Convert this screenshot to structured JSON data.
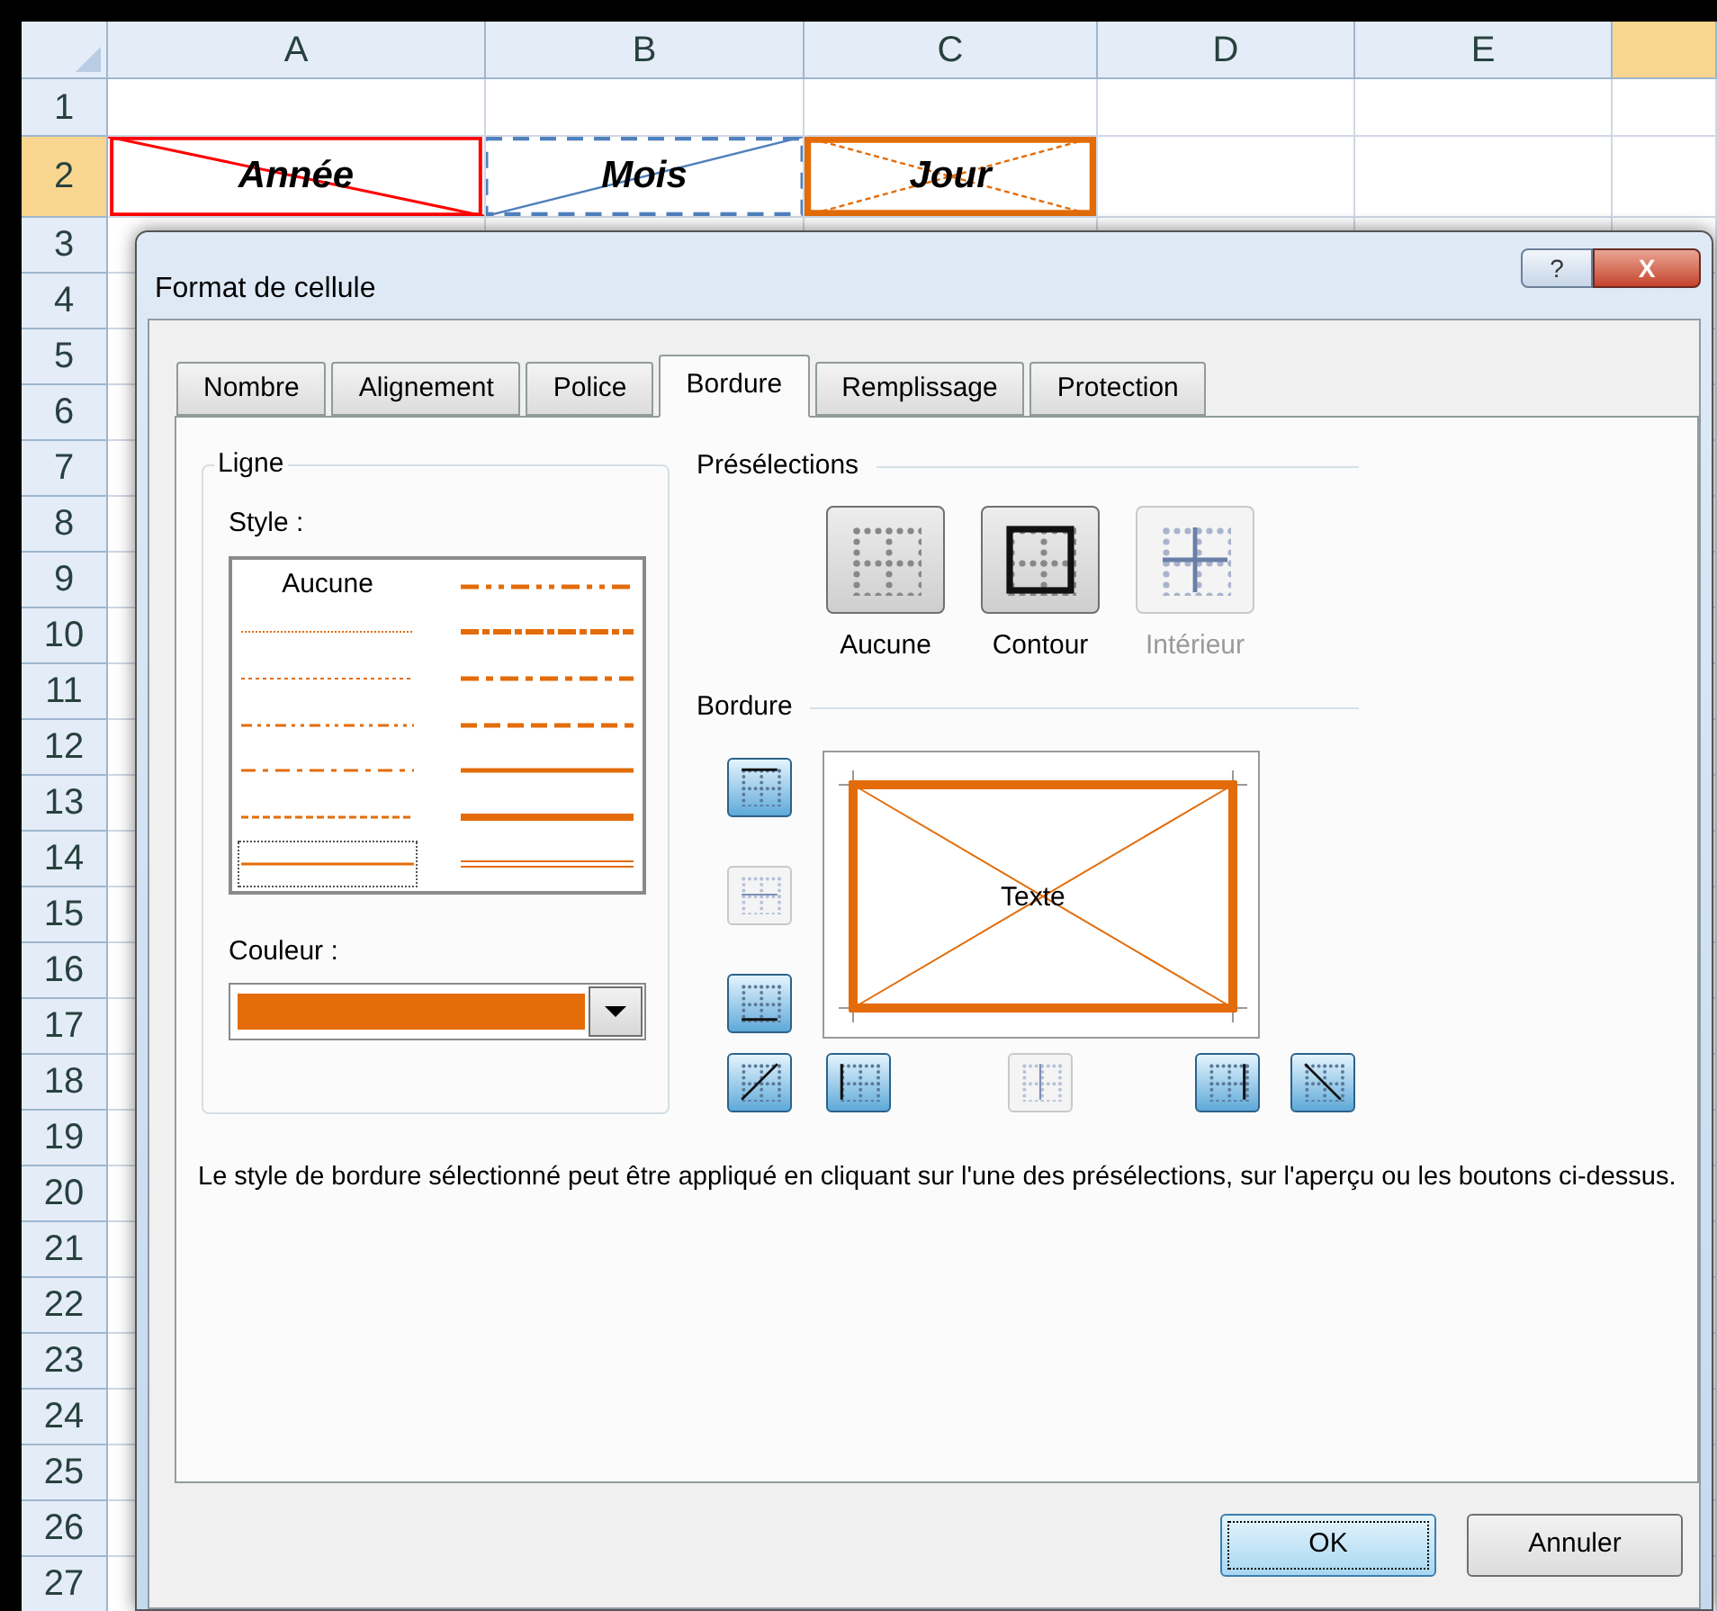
{
  "sheet": {
    "columns": [
      {
        "label": "A",
        "selected": false
      },
      {
        "label": "B",
        "selected": false
      },
      {
        "label": "C",
        "selected": false
      },
      {
        "label": "D",
        "selected": false
      },
      {
        "label": "E",
        "selected": false
      },
      {
        "selected": true
      }
    ],
    "rows": [
      {
        "label": "1",
        "selected": false
      },
      {
        "label": "2",
        "selected": true
      },
      {
        "label": "3",
        "selected": false
      },
      {
        "label": "4",
        "selected": false
      },
      {
        "label": "5",
        "selected": false
      },
      {
        "label": "6",
        "selected": false
      },
      {
        "label": "7",
        "selected": false
      },
      {
        "label": "8",
        "selected": false
      },
      {
        "label": "9",
        "selected": false
      },
      {
        "label": "10",
        "selected": false
      },
      {
        "label": "11",
        "selected": false
      },
      {
        "label": "12",
        "selected": false
      },
      {
        "label": "13",
        "selected": false
      },
      {
        "label": "14",
        "selected": false
      },
      {
        "label": "15",
        "selected": false
      },
      {
        "label": "16",
        "selected": false
      },
      {
        "label": "17",
        "selected": false
      },
      {
        "label": "18",
        "selected": false
      },
      {
        "label": "19",
        "selected": false
      },
      {
        "label": "20",
        "selected": false
      },
      {
        "label": "21",
        "selected": false
      },
      {
        "label": "22",
        "selected": false
      },
      {
        "label": "23",
        "selected": false
      },
      {
        "label": "24",
        "selected": false
      },
      {
        "label": "25",
        "selected": false
      },
      {
        "label": "26",
        "selected": false
      },
      {
        "label": "27",
        "selected": false
      }
    ],
    "cells": [
      {
        "text": "Année",
        "color": "#ff0000",
        "kind": "solid-diagonal-down"
      },
      {
        "text": "Mois",
        "color": "#4f81bd",
        "kind": "dashed-diagonal-up"
      },
      {
        "text": "Jour",
        "color": "#e36c09",
        "kind": "thick-cross"
      }
    ]
  },
  "dialog": {
    "title": "Format de cellule",
    "help": "?",
    "close": "X",
    "tabs": [
      {
        "label": "Nombre",
        "selected": false
      },
      {
        "label": "Alignement",
        "selected": false
      },
      {
        "label": "Police",
        "selected": false
      },
      {
        "label": "Bordure",
        "selected": true
      },
      {
        "label": "Remplissage",
        "selected": false
      },
      {
        "label": "Protection",
        "selected": false
      }
    ],
    "line_group": {
      "title": "Ligne",
      "style_label": "Style :",
      "styles": [
        {
          "kind": "none",
          "text": "Aucune",
          "selected": false
        },
        {
          "kind": "hair",
          "selected": false
        },
        {
          "kind": "dotted",
          "selected": false
        },
        {
          "kind": "dash-dot-dot",
          "selected": false
        },
        {
          "kind": "dash-dot",
          "selected": false
        },
        {
          "kind": "dashed",
          "selected": false
        },
        {
          "kind": "thin",
          "selected": true
        },
        {
          "kind": "medium-dash-dot-dot",
          "selected": false
        },
        {
          "kind": "slanted-dash-dot",
          "selected": false
        },
        {
          "kind": "medium-dash-dot",
          "selected": false
        },
        {
          "kind": "medium-dashed",
          "selected": false
        },
        {
          "kind": "medium",
          "selected": false
        },
        {
          "kind": "thick",
          "selected": false
        },
        {
          "kind": "double",
          "selected": false
        }
      ],
      "color_label": "Couleur :",
      "color": "#e36c09"
    },
    "presets_label": "Présélections",
    "presets": [
      {
        "kind": "none",
        "label": "Aucune",
        "disabled": false
      },
      {
        "kind": "outline",
        "label": "Contour",
        "disabled": false
      },
      {
        "kind": "inside",
        "label": "Intérieur",
        "disabled": true
      }
    ],
    "border_label": "Bordure",
    "preview_text": "Texte",
    "border_buttons": [
      {
        "kind": "top",
        "on": true,
        "disabled": false
      },
      {
        "kind": "middle-horizontal",
        "on": false,
        "disabled": true
      },
      {
        "kind": "bottom",
        "on": true,
        "disabled": false
      },
      {
        "kind": "diagonal-up",
        "on": true,
        "disabled": false
      },
      {
        "kind": "left",
        "on": true,
        "disabled": false
      },
      {
        "kind": "middle-vertical",
        "on": false,
        "disabled": true
      },
      {
        "kind": "right",
        "on": true,
        "disabled": false
      },
      {
        "kind": "diagonal-down",
        "on": true,
        "disabled": false
      }
    ],
    "description": "Le style de bordure sélectionné peut être appliqué en cliquant sur l'une des présélections, sur l'aperçu ou les boutons ci-dessus.",
    "buttons": [
      {
        "label": "OK",
        "default": true
      },
      {
        "label": "Annuler",
        "default": false
      }
    ]
  }
}
